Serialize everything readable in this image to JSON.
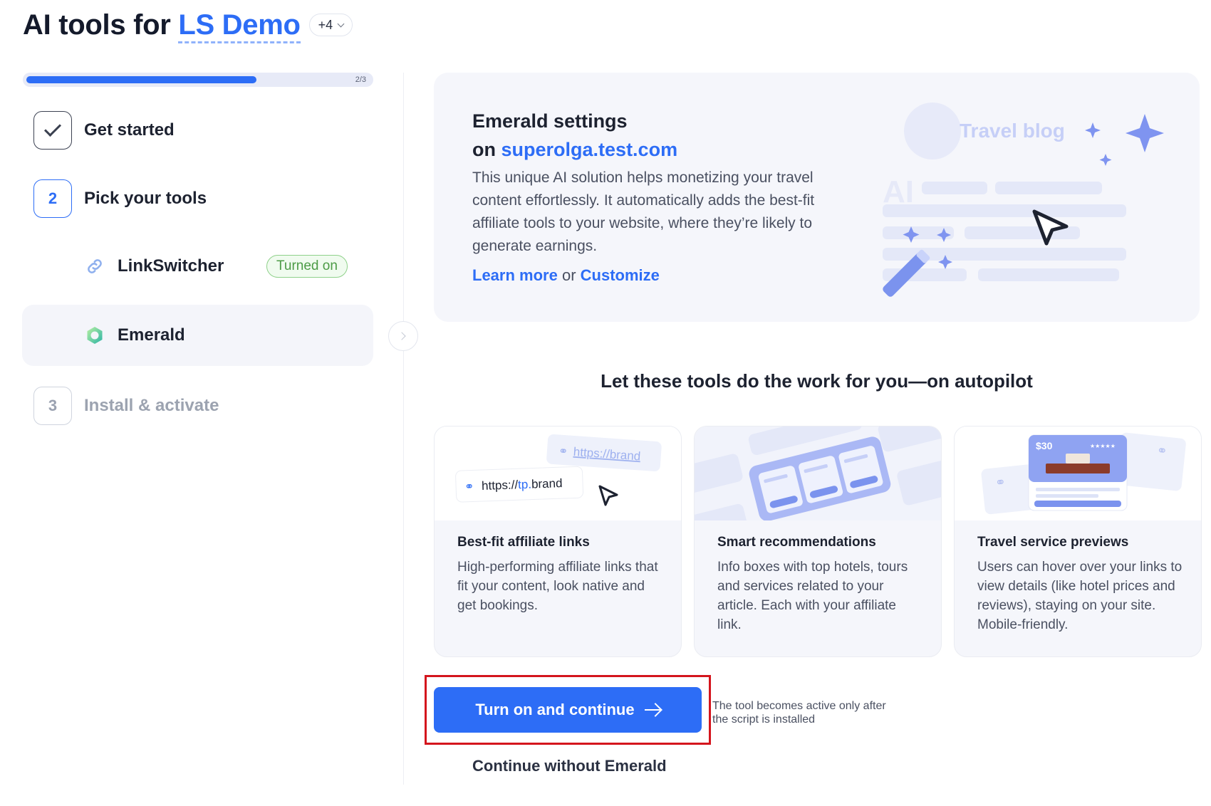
{
  "header": {
    "title_prefix": "AI tools for",
    "project_name": "LS Demo",
    "more_count": "+4"
  },
  "progress": {
    "label": "2/3",
    "fraction": 0.67
  },
  "steps": [
    {
      "number": "",
      "label": "Get started",
      "state": "done"
    },
    {
      "number": "2",
      "label": "Pick your tools",
      "state": "active"
    },
    {
      "number": "3",
      "label": "Install & activate",
      "state": "future"
    }
  ],
  "tools": [
    {
      "name": "LinkSwitcher",
      "badge": "Turned on",
      "icon": "link-icon"
    },
    {
      "name": "Emerald",
      "badge": "",
      "icon": "emerald-logo-icon",
      "selected": true
    }
  ],
  "hero": {
    "title_line1": "Emerald settings",
    "title_on": "on",
    "domain": "superolga.test.com",
    "description": "This unique AI solution helps monetizing your travel content effortlessly. It automatically adds the best-fit affiliate tools to your website, where they’re likely to generate earnings.",
    "learn_more": "Learn more",
    "or_text": "or",
    "customize": "Customize",
    "illustration": {
      "blog_label": "Travel blog",
      "ai_label": "AI"
    }
  },
  "features": {
    "title": "Let these tools do the work for you—on autopilot",
    "cards": [
      {
        "title": "Best-fit affiliate links",
        "desc": "High-performing affiliate links that fit your content, look native and get bookings.",
        "art": {
          "url_back": "https://brand",
          "url_front_prefix": "https://",
          "url_front_tp": "tp.",
          "url_front_suffix": "brand"
        }
      },
      {
        "title": "Smart recommendations",
        "desc": "Info boxes with top hotels, tours and services related to your article. Each with your affiliate link."
      },
      {
        "title": "Travel service previews",
        "desc": "Users can hover over your links to view details (like hotel prices and reviews), staying on your site. Mobile-friendly.",
        "art": {
          "price": "$30",
          "stars": "★★★★★"
        }
      }
    ]
  },
  "actions": {
    "primary": "Turn on and continue",
    "note": "The tool becomes active only after the script is installed",
    "secondary": "Continue without Emerald"
  },
  "colors": {
    "accent": "#2D6DF6",
    "success": "#4C9B46",
    "highlight": "#D4151D"
  }
}
